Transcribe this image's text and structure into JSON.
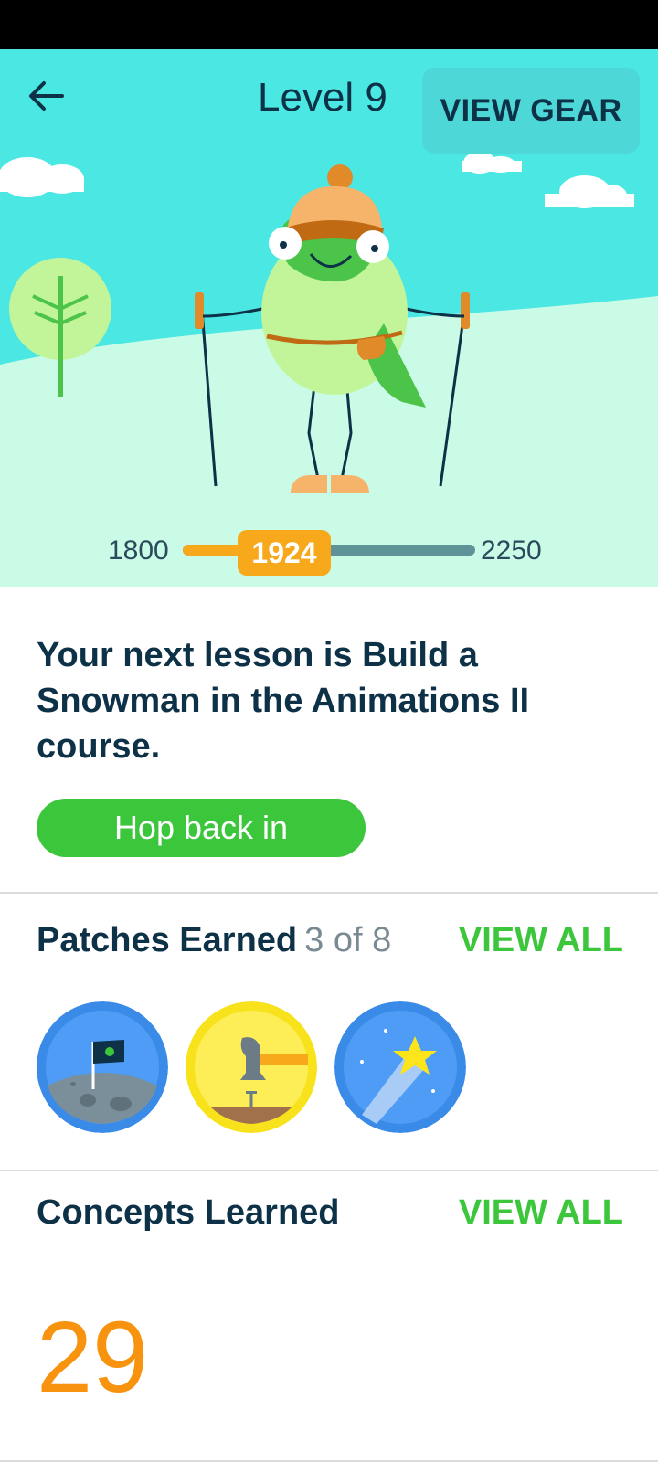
{
  "header": {
    "level_title": "Level 9",
    "view_gear_label": "VIEW GEAR"
  },
  "progress": {
    "min_label": "1800",
    "max_label": "2250",
    "current_label": "1924",
    "min": 1800,
    "max": 2250,
    "current": 1924
  },
  "next_lesson": {
    "text": "Your next lesson is Build a Snowman in the Animations II course.",
    "button_label": "Hop back in"
  },
  "patches": {
    "title": "Patches Earned",
    "count_label": "3 of 8",
    "view_all_label": "VIEW ALL",
    "items": [
      "moon-flag-patch",
      "hammer-nail-patch",
      "shooting-star-patch"
    ]
  },
  "concepts": {
    "title": "Concepts Learned",
    "view_all_label": "VIEW ALL",
    "count": "29"
  },
  "colors": {
    "sky": "#4be7e3",
    "hill": "#c9fbe7",
    "accent_green": "#3cc63c",
    "accent_orange": "#f7a81b",
    "text_dark": "#0d3147"
  }
}
